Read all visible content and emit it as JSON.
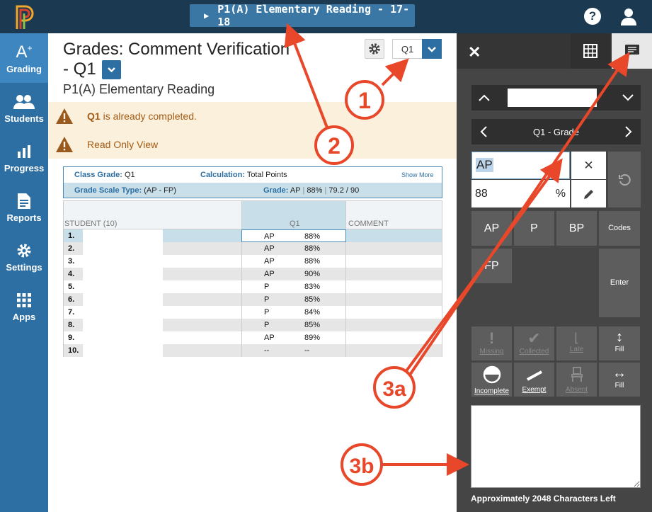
{
  "header": {
    "class_button": "P1(A) Elementary Reading - 17-18",
    "icons": [
      "powerschool-logo",
      "play-icon",
      "help-icon",
      "user-icon"
    ]
  },
  "sidenav": {
    "items": [
      {
        "label": "Grading",
        "icon": "grading-icon",
        "active": true
      },
      {
        "label": "Students",
        "icon": "students-icon"
      },
      {
        "label": "Progress",
        "icon": "progress-icon"
      },
      {
        "label": "Reports",
        "icon": "reports-icon"
      },
      {
        "label": "Settings",
        "icon": "settings-icon"
      },
      {
        "label": "Apps",
        "icon": "apps-icon"
      }
    ]
  },
  "page": {
    "title_line1": "Grades: Comment Verification",
    "title_line2": "- Q1",
    "subtitle": "P1(A) Elementary Reading",
    "term_value": "Q1"
  },
  "alerts": {
    "completed_term": "Q1",
    "completed_text": " is already completed.",
    "read_only": "Read Only View"
  },
  "info": {
    "class_grade_label": "Class Grade:",
    "class_grade_value": "Q1",
    "calculation_label": "Calculation:",
    "calculation_value": "Total Points",
    "show_more": "Show More",
    "scale_label": "Grade Scale Type:",
    "scale_value": "(AP - FP)",
    "grade_label": "Grade:",
    "grade_letter": "AP",
    "grade_percent": "88%",
    "grade_points": "79.2 / 90",
    "sep": "|"
  },
  "grid": {
    "col_student": "STUDENT (10)",
    "col_q1": "Q1",
    "col_comment": "COMMENT",
    "rows": [
      {
        "n": "1.",
        "a": "AP",
        "p": "88%"
      },
      {
        "n": "2.",
        "a": "AP",
        "p": "88%"
      },
      {
        "n": "3.",
        "a": "AP",
        "p": "88%"
      },
      {
        "n": "4.",
        "a": "AP",
        "p": "90%"
      },
      {
        "n": "5.",
        "a": "P",
        "p": "83%"
      },
      {
        "n": "6.",
        "a": "P",
        "p": "85%"
      },
      {
        "n": "7.",
        "a": "P",
        "p": "84%"
      },
      {
        "n": "8.",
        "a": "P",
        "p": "85%"
      },
      {
        "n": "9.",
        "a": "AP",
        "p": "89%"
      },
      {
        "n": "10.",
        "a": "--",
        "p": "--"
      }
    ]
  },
  "panel": {
    "term_grade": "Q1 - Grade",
    "grade_value": "AP",
    "percent_value": "88",
    "percent_sign": "%",
    "btn_ap": "AP",
    "btn_p": "P",
    "btn_bp": "BP",
    "btn_codes": "Codes",
    "btn_fp": "FP",
    "btn_enter": "Enter",
    "missing": "Missing",
    "collected": "Collected",
    "late": "Late",
    "fill1": "Fill",
    "incomplete": "Incomplete",
    "exempt": "Exempt",
    "absent": "Absent",
    "fill2": "Fill",
    "chars_left": "Approximately 2048 Characters Left"
  },
  "annotations": {
    "a1": "1",
    "a2": "2",
    "a3a": "3a",
    "a3b": "3b",
    "color": "#e8472a"
  }
}
